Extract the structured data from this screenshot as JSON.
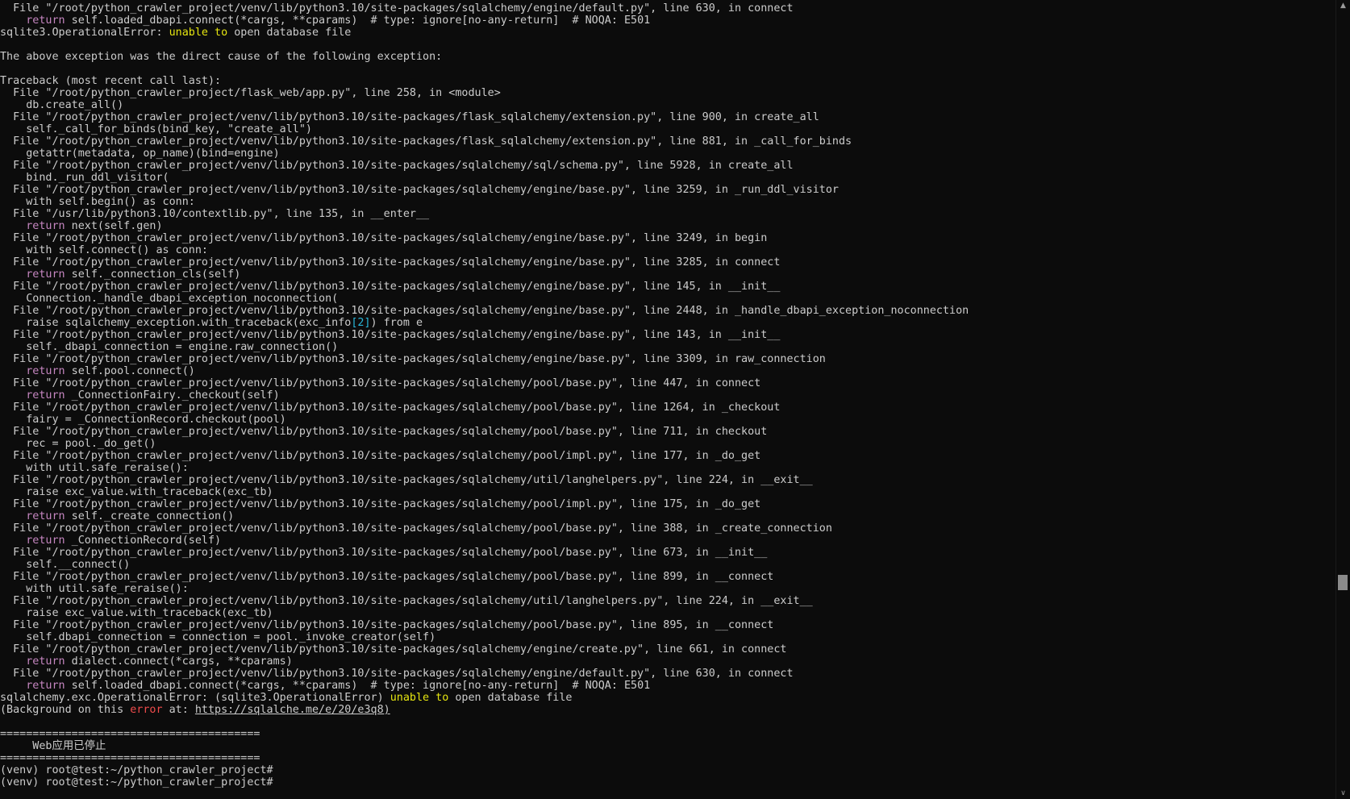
{
  "scrollbar": {
    "up_icon": "▲",
    "down_icon": "∨",
    "thumb_position_fraction": 0.74
  },
  "lines": [
    [
      {
        "t": "  File \"/root/python_crawler_project/venv/lib/python3.10/site-packages/sqlalchemy/engine/default.py\", line 630, in connect"
      }
    ],
    [
      {
        "t": "    "
      },
      {
        "t": "return",
        "c": "kw"
      },
      {
        "t": " self.loaded_dbapi.connect(*cargs, **cparams)  # type: ignore[no-any-return]  # NOQA: E501"
      }
    ],
    [
      {
        "t": "sqlite3.OperationalError: "
      },
      {
        "t": "unable to",
        "c": "warn"
      },
      {
        "t": " open database file"
      }
    ],
    [
      {
        "t": ""
      }
    ],
    [
      {
        "t": "The above exception was the direct cause of the following exception:"
      }
    ],
    [
      {
        "t": ""
      }
    ],
    [
      {
        "t": "Traceback (most recent call last):"
      }
    ],
    [
      {
        "t": "  File \"/root/python_crawler_project/flask_web/app.py\", line 258, in <module>"
      }
    ],
    [
      {
        "t": "    db.create_all()"
      }
    ],
    [
      {
        "t": "  File \"/root/python_crawler_project/venv/lib/python3.10/site-packages/flask_sqlalchemy/extension.py\", line 900, in create_all"
      }
    ],
    [
      {
        "t": "    self._call_for_binds(bind_key, \"create_all\")"
      }
    ],
    [
      {
        "t": "  File \"/root/python_crawler_project/venv/lib/python3.10/site-packages/flask_sqlalchemy/extension.py\", line 881, in _call_for_binds"
      }
    ],
    [
      {
        "t": "    getattr(metadata, op_name)(bind=engine)"
      }
    ],
    [
      {
        "t": "  File \"/root/python_crawler_project/venv/lib/python3.10/site-packages/sqlalchemy/sql/schema.py\", line 5928, in create_all"
      }
    ],
    [
      {
        "t": "    bind._run_ddl_visitor("
      }
    ],
    [
      {
        "t": "  File \"/root/python_crawler_project/venv/lib/python3.10/site-packages/sqlalchemy/engine/base.py\", line 3259, in _run_ddl_visitor"
      }
    ],
    [
      {
        "t": "    with self.begin() as conn:"
      }
    ],
    [
      {
        "t": "  File \"/usr/lib/python3.10/contextlib.py\", line 135, in __enter__"
      }
    ],
    [
      {
        "t": "    "
      },
      {
        "t": "return",
        "c": "kw"
      },
      {
        "t": " next(self.gen)"
      }
    ],
    [
      {
        "t": "  File \"/root/python_crawler_project/venv/lib/python3.10/site-packages/sqlalchemy/engine/base.py\", line 3249, in begin"
      }
    ],
    [
      {
        "t": "    with self.connect() as conn:"
      }
    ],
    [
      {
        "t": "  File \"/root/python_crawler_project/venv/lib/python3.10/site-packages/sqlalchemy/engine/base.py\", line 3285, in connect"
      }
    ],
    [
      {
        "t": "    "
      },
      {
        "t": "return",
        "c": "kw"
      },
      {
        "t": " self._connection_cls(self)"
      }
    ],
    [
      {
        "t": "  File \"/root/python_crawler_project/venv/lib/python3.10/site-packages/sqlalchemy/engine/base.py\", line 145, in __init__"
      }
    ],
    [
      {
        "t": "    Connection._handle_dbapi_exception_noconnection("
      }
    ],
    [
      {
        "t": "  File \"/root/python_crawler_project/venv/lib/python3.10/site-packages/sqlalchemy/engine/base.py\", line 2448, in _handle_dbapi_exception_noconnection"
      }
    ],
    [
      {
        "t": "    raise sqlalchemy_exception.with_traceback(exc_info"
      },
      {
        "t": "[2]",
        "c": "num"
      },
      {
        "t": ") from e"
      }
    ],
    [
      {
        "t": "  File \"/root/python_crawler_project/venv/lib/python3.10/site-packages/sqlalchemy/engine/base.py\", line 143, in __init__"
      }
    ],
    [
      {
        "t": "    self._dbapi_connection = engine.raw_connection()"
      }
    ],
    [
      {
        "t": "  File \"/root/python_crawler_project/venv/lib/python3.10/site-packages/sqlalchemy/engine/base.py\", line 3309, in raw_connection"
      }
    ],
    [
      {
        "t": "    "
      },
      {
        "t": "return",
        "c": "kw"
      },
      {
        "t": " self.pool.connect()"
      }
    ],
    [
      {
        "t": "  File \"/root/python_crawler_project/venv/lib/python3.10/site-packages/sqlalchemy/pool/base.py\", line 447, in connect"
      }
    ],
    [
      {
        "t": "    "
      },
      {
        "t": "return",
        "c": "kw"
      },
      {
        "t": " _ConnectionFairy._checkout(self)"
      }
    ],
    [
      {
        "t": "  File \"/root/python_crawler_project/venv/lib/python3.10/site-packages/sqlalchemy/pool/base.py\", line 1264, in _checkout"
      }
    ],
    [
      {
        "t": "    fairy = _ConnectionRecord.checkout(pool)"
      }
    ],
    [
      {
        "t": "  File \"/root/python_crawler_project/venv/lib/python3.10/site-packages/sqlalchemy/pool/base.py\", line 711, in checkout"
      }
    ],
    [
      {
        "t": "    rec = pool._do_get()"
      }
    ],
    [
      {
        "t": "  File \"/root/python_crawler_project/venv/lib/python3.10/site-packages/sqlalchemy/pool/impl.py\", line 177, in _do_get"
      }
    ],
    [
      {
        "t": "    with util.safe_reraise():"
      }
    ],
    [
      {
        "t": "  File \"/root/python_crawler_project/venv/lib/python3.10/site-packages/sqlalchemy/util/langhelpers.py\", line 224, in __exit__"
      }
    ],
    [
      {
        "t": "    raise exc_value.with_traceback(exc_tb)"
      }
    ],
    [
      {
        "t": "  File \"/root/python_crawler_project/venv/lib/python3.10/site-packages/sqlalchemy/pool/impl.py\", line 175, in _do_get"
      }
    ],
    [
      {
        "t": "    "
      },
      {
        "t": "return",
        "c": "kw"
      },
      {
        "t": " self._create_connection()"
      }
    ],
    [
      {
        "t": "  File \"/root/python_crawler_project/venv/lib/python3.10/site-packages/sqlalchemy/pool/base.py\", line 388, in _create_connection"
      }
    ],
    [
      {
        "t": "    "
      },
      {
        "t": "return",
        "c": "kw"
      },
      {
        "t": " _ConnectionRecord(self)"
      }
    ],
    [
      {
        "t": "  File \"/root/python_crawler_project/venv/lib/python3.10/site-packages/sqlalchemy/pool/base.py\", line 673, in __init__"
      }
    ],
    [
      {
        "t": "    self.__connect()"
      }
    ],
    [
      {
        "t": "  File \"/root/python_crawler_project/venv/lib/python3.10/site-packages/sqlalchemy/pool/base.py\", line 899, in __connect"
      }
    ],
    [
      {
        "t": "    with util.safe_reraise():"
      }
    ],
    [
      {
        "t": "  File \"/root/python_crawler_project/venv/lib/python3.10/site-packages/sqlalchemy/util/langhelpers.py\", line 224, in __exit__"
      }
    ],
    [
      {
        "t": "    raise exc_value.with_traceback(exc_tb)"
      }
    ],
    [
      {
        "t": "  File \"/root/python_crawler_project/venv/lib/python3.10/site-packages/sqlalchemy/pool/base.py\", line 895, in __connect"
      }
    ],
    [
      {
        "t": "    self.dbapi_connection = connection = pool._invoke_creator(self)"
      }
    ],
    [
      {
        "t": "  File \"/root/python_crawler_project/venv/lib/python3.10/site-packages/sqlalchemy/engine/create.py\", line 661, in connect"
      }
    ],
    [
      {
        "t": "    "
      },
      {
        "t": "return",
        "c": "kw"
      },
      {
        "t": " dialect.connect(*cargs, **cparams)"
      }
    ],
    [
      {
        "t": "  File \"/root/python_crawler_project/venv/lib/python3.10/site-packages/sqlalchemy/engine/default.py\", line 630, in connect"
      }
    ],
    [
      {
        "t": "    "
      },
      {
        "t": "return",
        "c": "kw"
      },
      {
        "t": " self.loaded_dbapi.connect(*cargs, **cparams)  # type: ignore[no-any-return]  # NOQA: E501"
      }
    ],
    [
      {
        "t": "sqlalchemy.exc.OperationalError: (sqlite3.OperationalError) "
      },
      {
        "t": "unable to",
        "c": "warn"
      },
      {
        "t": " open database file"
      }
    ],
    [
      {
        "t": "(Background on this "
      },
      {
        "t": "error",
        "c": "err"
      },
      {
        "t": " at: "
      },
      {
        "t": "https://sqlalche.me/e/20/e3q8)",
        "c": "url"
      }
    ],
    [
      {
        "t": ""
      }
    ],
    [
      {
        "t": "========================================"
      }
    ],
    [
      {
        "t": "     Web应用已停止"
      }
    ],
    [
      {
        "t": "========================================"
      }
    ],
    [
      {
        "t": "(venv) root@test:~/python_crawler_project#"
      }
    ],
    [
      {
        "t": "(venv) root@test:~/python_crawler_project#"
      }
    ]
  ]
}
